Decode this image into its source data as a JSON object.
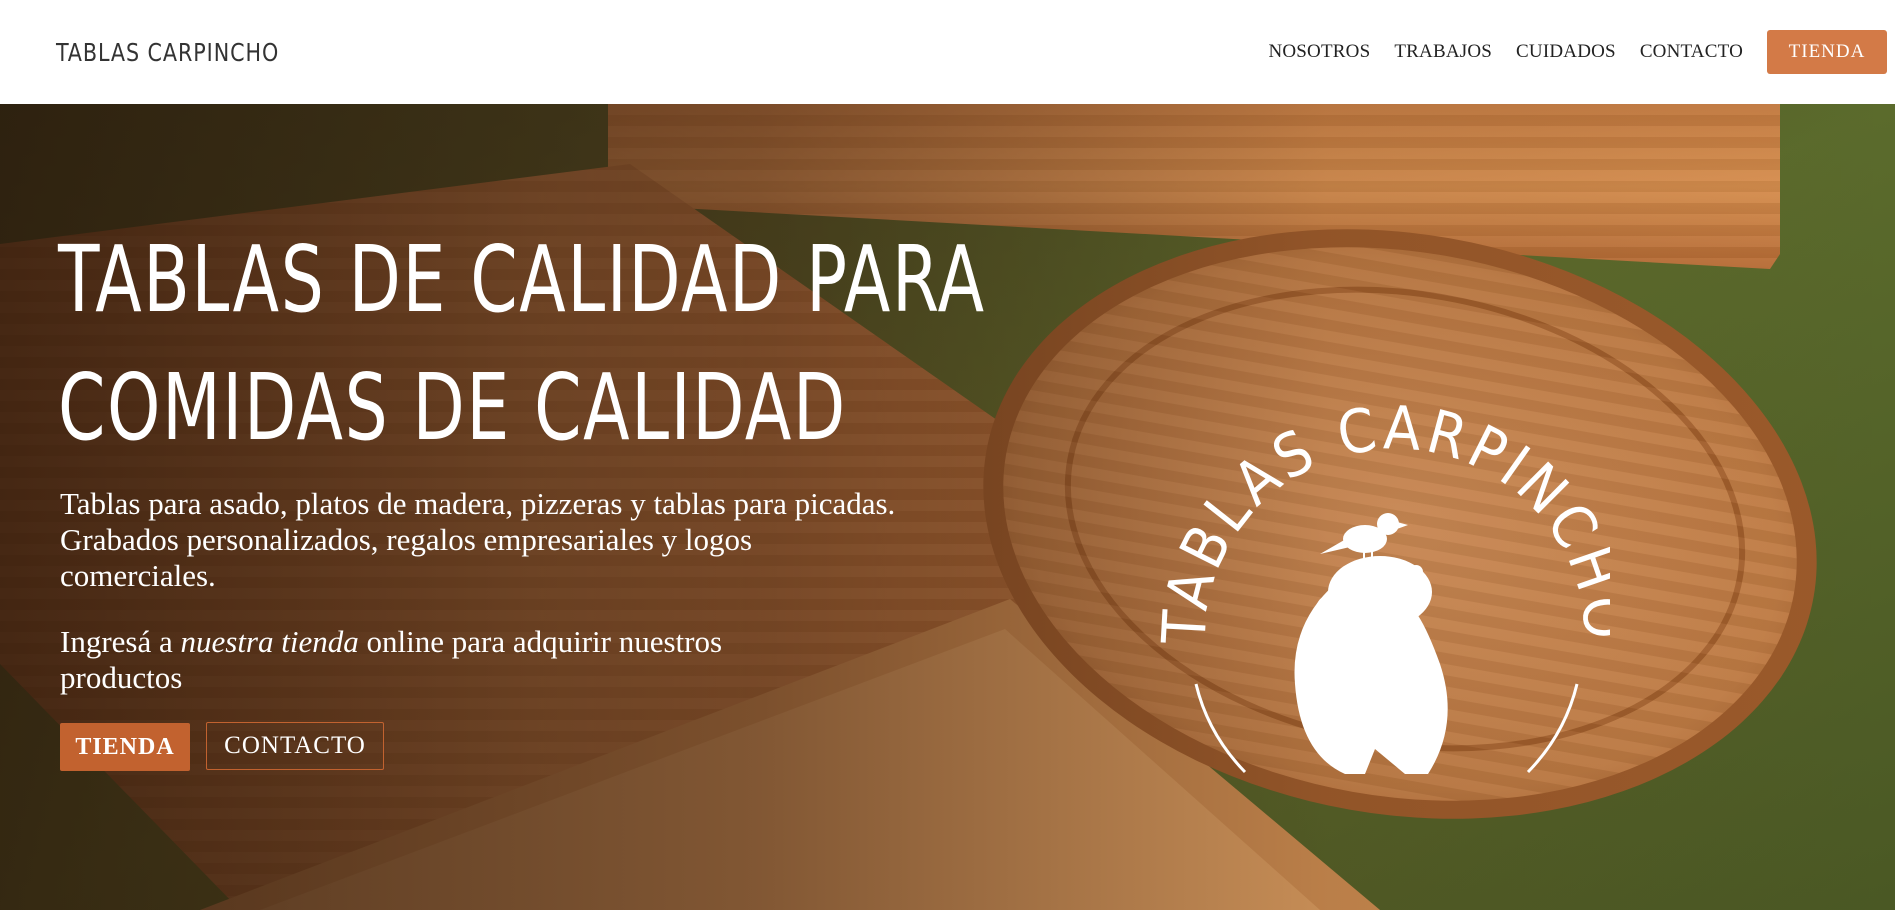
{
  "header": {
    "brand": "TABLAS CARPINCHO",
    "nav": [
      "NOSOTROS",
      "TRABAJOS",
      "CUIDADOS",
      "CONTACTO"
    ],
    "store_button": "TIENDA"
  },
  "hero": {
    "headline_line1": "TABLAS DE CALIDAD PARA",
    "headline_line2": "COMIDAS DE CALIDAD",
    "description": "Tablas para asado, platos de madera, pizzeras y tablas para picadas. Grabados personalizados, regalos empresariales y logos comerciales.",
    "cta_prefix": "Ingresá a ",
    "cta_link": "nuestra tienda",
    "cta_suffix": " online para adquirir nuestros productos",
    "primary_button": "TIENDA",
    "secondary_button": "CONTACTO"
  },
  "logo": {
    "arc_text": "TABLAS CARPINCHO",
    "icon": "capybara-with-bird-icon"
  },
  "colors": {
    "accent": "#d37a47",
    "accent_dark": "#c2622f",
    "text_dark": "#222222",
    "hero_text": "#ffffff"
  }
}
